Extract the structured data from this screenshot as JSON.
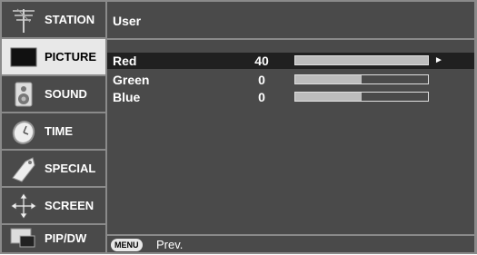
{
  "sidebar": {
    "items": [
      {
        "label": "STATION",
        "icon": "antenna-icon",
        "active": false
      },
      {
        "label": "PICTURE",
        "icon": "tv-screen-icon",
        "active": true
      },
      {
        "label": "SOUND",
        "icon": "speaker-icon",
        "active": false
      },
      {
        "label": "TIME",
        "icon": "clock-icon",
        "active": false
      },
      {
        "label": "SPECIAL",
        "icon": "tag-icon",
        "active": false
      },
      {
        "label": "SCREEN",
        "icon": "move-arrows-icon",
        "active": false
      },
      {
        "label": "PIP/DW",
        "icon": "pip-windows-icon",
        "active": false
      }
    ]
  },
  "panel": {
    "title": "User",
    "rows": [
      {
        "label": "Red",
        "value": "40",
        "level": 1.0,
        "active": true
      },
      {
        "label": "Green",
        "value": "0",
        "level": 0.5,
        "active": false
      },
      {
        "label": "Blue",
        "value": "0",
        "level": 0.5,
        "active": false
      }
    ],
    "arrow": "►"
  },
  "footer": {
    "menu_key": "MENU",
    "prev_label": "Prev."
  },
  "colors": {
    "frame": "#8a8a8a",
    "panel": "#4a4a4a",
    "active_sidebar": "#e8e8e8",
    "bar_fill": "#bdbdbd"
  }
}
